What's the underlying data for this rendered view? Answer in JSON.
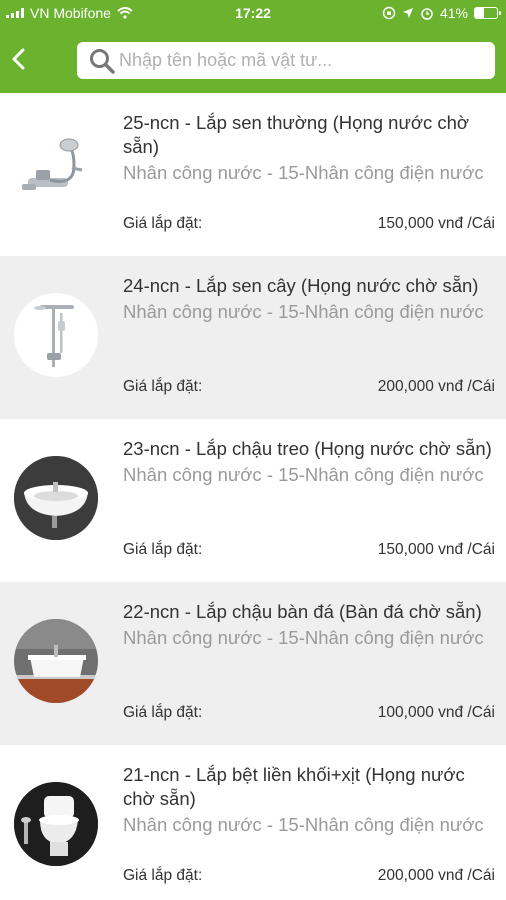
{
  "status_bar": {
    "carrier": "VN Mobifone",
    "time": "17:22",
    "battery_percent": "41%",
    "battery_level": 0.41
  },
  "search": {
    "placeholder": "Nhập tên hoặc mã vật tư..."
  },
  "colors": {
    "header": "#6bb22e",
    "alt_row": "#efefef"
  },
  "items": [
    {
      "title": "25-ncn - Lắp sen thường (Họng nước chờ sẵn)",
      "category": "Nhân công nước - 15-Nhân công điện nước",
      "price_label": "Giá lắp đặt:",
      "price": "150,000 vnđ /Cái",
      "icon": "shower-mixer"
    },
    {
      "title": "24-ncn - Lắp sen cây (Họng nước chờ sẵn)",
      "category": "Nhân công nước - 15-Nhân công điện nước",
      "price_label": "Giá lắp đặt:",
      "price": "200,000 vnđ /Cái",
      "icon": "shower-column"
    },
    {
      "title": "23-ncn - Lắp chậu treo (Họng nước chờ sẵn)",
      "category": "Nhân công nước - 15-Nhân công điện nước",
      "price_label": "Giá lắp đặt:",
      "price": "150,000 vnđ /Cái",
      "icon": "wall-basin"
    },
    {
      "title": "22-ncn - Lắp chậu bàn đá (Bàn đá chờ sẵn)",
      "category": "Nhân công nước - 15-Nhân công điện nước",
      "price_label": "Giá lắp đặt:",
      "price": "100,000 vnđ /Cái",
      "icon": "counter-basin"
    },
    {
      "title": "21-ncn - Lắp bệt liền khối+xịt (Họng nước chờ sẵn)",
      "category": "Nhân công nước - 15-Nhân công điện nước",
      "price_label": "Giá lắp đặt:",
      "price": "200,000 vnđ /Cái",
      "icon": "toilet"
    }
  ]
}
